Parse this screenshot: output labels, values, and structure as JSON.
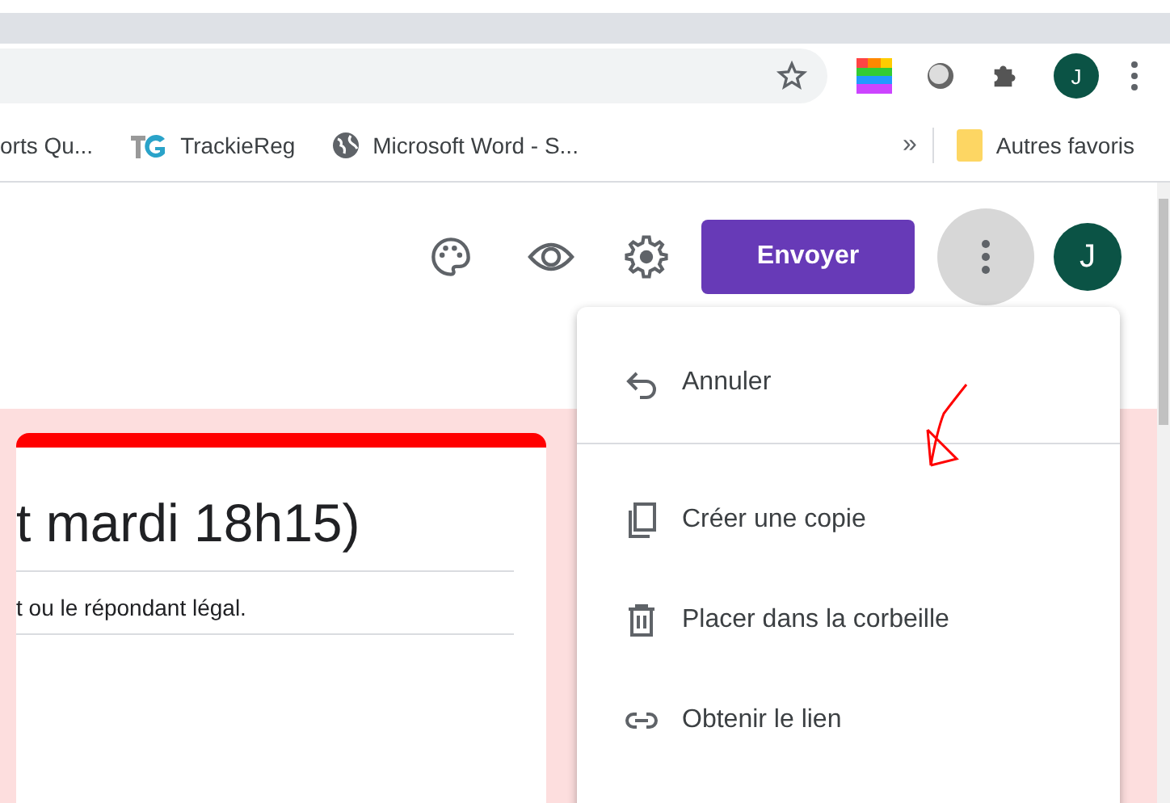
{
  "toolbar": {
    "avatar": "J"
  },
  "bookmarks": [
    {
      "label": "orts Qu...",
      "kind": "cut"
    },
    {
      "label": "TrackieReg",
      "kind": "tg"
    },
    {
      "label": "Microsoft Word - S...",
      "kind": "globe"
    }
  ],
  "bookmarks_more": "»",
  "other_bookmarks": "Autres favoris",
  "header": {
    "send_button": "Envoyer",
    "avatar": "J",
    "more_open": true
  },
  "form": {
    "title": "t mardi 18h15)",
    "description": "t ou le répondant légal."
  },
  "menu": [
    {
      "label": "Annuler",
      "kind": "undo"
    },
    {
      "label": "Créer une copie",
      "kind": "copy"
    },
    {
      "label": "Placer dans la corbeille",
      "kind": "trash"
    },
    {
      "label": "Obtenir le lien",
      "kind": "link"
    }
  ]
}
